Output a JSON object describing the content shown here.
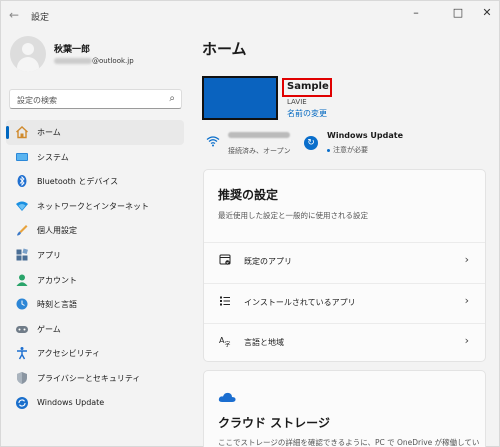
{
  "window": {
    "title": "設定"
  },
  "user": {
    "name": "秋葉一郎",
    "email_suffix": "@outlook.jp"
  },
  "search": {
    "placeholder": "設定の検索"
  },
  "sidebar": {
    "items": [
      {
        "label": "ホーム",
        "icon": "home-icon",
        "active": true
      },
      {
        "label": "システム",
        "icon": "system-icon"
      },
      {
        "label": "Bluetooth とデバイス",
        "icon": "bluetooth-icon"
      },
      {
        "label": "ネットワークとインターネット",
        "icon": "network-icon"
      },
      {
        "label": "個人用設定",
        "icon": "brush-icon"
      },
      {
        "label": "アプリ",
        "icon": "apps-icon"
      },
      {
        "label": "アカウント",
        "icon": "account-icon"
      },
      {
        "label": "時刻と言語",
        "icon": "time-language-icon"
      },
      {
        "label": "ゲーム",
        "icon": "gaming-icon"
      },
      {
        "label": "アクセシビリティ",
        "icon": "accessibility-icon"
      },
      {
        "label": "プライバシーとセキュリティ",
        "icon": "shield-icon"
      },
      {
        "label": "Windows Update",
        "icon": "windows-update-icon"
      }
    ]
  },
  "main": {
    "title": "ホーム",
    "device": {
      "name": "Sample",
      "model": "LAVIE",
      "rename_label": "名前の変更"
    },
    "network": {
      "status": "接続済み、オープン"
    },
    "update": {
      "title": "Windows Update",
      "status": "注意が必要"
    },
    "recommended": {
      "title": "推奨の設定",
      "description": "最近使用した設定と一般的に使用される設定",
      "rows": [
        {
          "label": "既定のアプリ",
          "icon": "default-apps-icon"
        },
        {
          "label": "インストールされているアプリ",
          "icon": "installed-apps-icon"
        },
        {
          "label": "言語と地域",
          "icon": "language-region-icon"
        }
      ]
    },
    "cloud": {
      "title": "クラウド ストレージ",
      "description": "ここでストレージの詳細を確認できるように、PC で OneDrive が稼働してい"
    }
  },
  "colors": {
    "accent": "#0067c0",
    "highlight_box": "#e00000",
    "device_tile": "#0a63bf"
  }
}
